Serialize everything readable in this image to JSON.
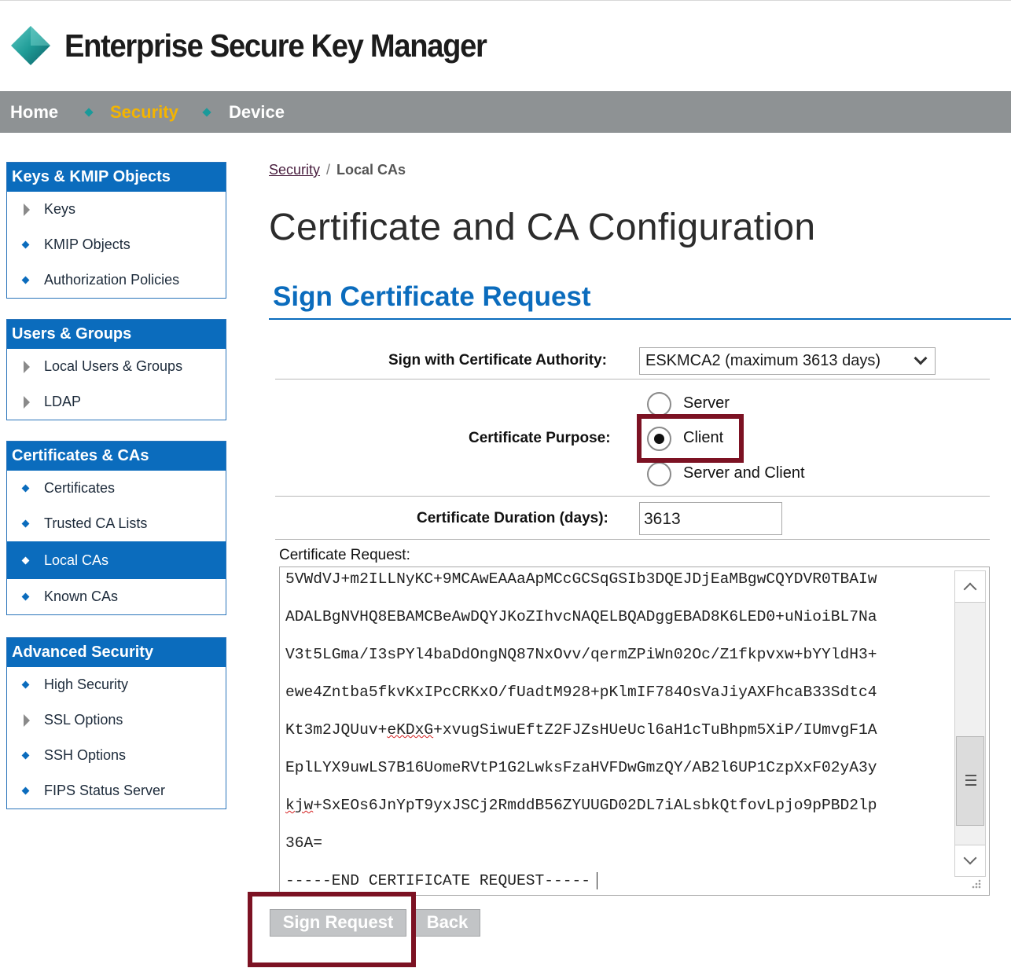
{
  "app": {
    "title": "Enterprise Secure Key Manager",
    "logo_icon": "diamond-logo",
    "accent_color": "#0b6cbd",
    "nav_active_color": "#f4b400",
    "highlight_color": "#7c1223"
  },
  "nav": {
    "items": [
      {
        "label": "Home",
        "active": false
      },
      {
        "label": "Security",
        "active": true
      },
      {
        "label": "Device",
        "active": false
      }
    ]
  },
  "sidebar": {
    "keys": {
      "heading": "Keys & KMIP Objects",
      "items": [
        {
          "label": "Keys",
          "icon": "triangle"
        },
        {
          "label": "KMIP Objects",
          "icon": "diamond"
        },
        {
          "label": "Authorization Policies",
          "icon": "diamond"
        }
      ]
    },
    "users": {
      "heading": "Users & Groups",
      "items": [
        {
          "label": "Local Users & Groups",
          "icon": "triangle"
        },
        {
          "label": "LDAP",
          "icon": "triangle"
        }
      ]
    },
    "certs": {
      "heading": "Certificates & CAs",
      "items": [
        {
          "label": "Certificates",
          "icon": "diamond"
        },
        {
          "label": "Trusted CA Lists",
          "icon": "diamond"
        },
        {
          "label": "Local CAs",
          "icon": "diamond",
          "active": true
        },
        {
          "label": "Known CAs",
          "icon": "diamond"
        }
      ]
    },
    "advanced": {
      "heading": "Advanced Security",
      "items": [
        {
          "label": "High Security",
          "icon": "diamond"
        },
        {
          "label": "SSL Options",
          "icon": "triangle"
        },
        {
          "label": "SSH Options",
          "icon": "diamond"
        },
        {
          "label": "FIPS Status Server",
          "icon": "diamond"
        }
      ]
    }
  },
  "breadcrumb": {
    "link": "Security",
    "separator": "/",
    "current": "Local CAs"
  },
  "page": {
    "title": "Certificate and CA Configuration",
    "section_title": "Sign Certificate Request"
  },
  "form": {
    "ca_label": "Sign with Certificate Authority:",
    "ca_value": "ESKMCA2 (maximum 3613 days)",
    "purpose_label": "Certificate Purpose:",
    "purpose_options": [
      {
        "label": "Server",
        "checked": false
      },
      {
        "label": "Client",
        "checked": true
      },
      {
        "label": "Server and Client",
        "checked": false
      }
    ],
    "duration_label": "Certificate Duration (days):",
    "duration_value": "3613",
    "request_label": "Certificate Request:",
    "request_lines": [
      "5VWdVJ+m2ILLNyKC+9MCAwEAAaApMCcGCSqGSIb3DQEJDjEaMBgwCQYDVR0TBAIw",
      "ADALBgNVHQ8EBAMCBeAwDQYJKoZIhvcNAQELBQADggEBAD8K6LED0+uNioiBL7Na",
      "V3t5LGma/I3sPYl4baDdOngNQ87NxOvv/qermZPiWn02Oc/Z1fkpvxw+bYYldH3+",
      "ewe4Zntba5fkvKxIPcCRKxO/fUadtM928+pKlmIF784OsVaJiyAXFhcaB33Sdtc4",
      {
        "before": "Kt3m2JQUuv+",
        "flagged": "eKDxG",
        "after": "+xvugSiwuEftZ2FJZsHUeUcl6aH1cTuBhpm5XiP/IUmvgF1A"
      },
      "EplLYX9uwLS7B16UomeRVtP1G2LwksFzaHVFDwGmzQY/AB2l6UP1CzpXxF02yA3y",
      {
        "before": "",
        "flagged": "kjw",
        "after": "+SxEOs6JnYpT9yxJSCj2RmddB56ZYUUGD02DL7iALsbkQtfovLpjo9pPBD2lp"
      },
      "36A=",
      "-----END CERTIFICATE REQUEST-----"
    ]
  },
  "buttons": {
    "sign": "Sign Request",
    "back": "Back"
  }
}
